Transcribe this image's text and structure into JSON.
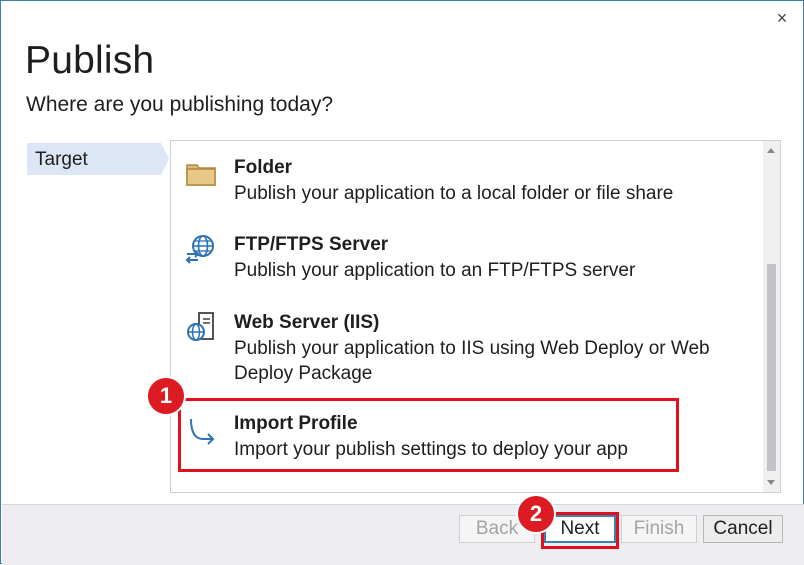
{
  "window": {
    "close_glyph": "×",
    "title": "Publish",
    "subtitle": "Where are you publishing today?"
  },
  "nav": {
    "items": [
      {
        "label": "Target",
        "selected": true
      }
    ]
  },
  "targets": [
    {
      "title": "Folder",
      "description": "Publish your application to a local folder or file share",
      "icon": "folder-icon"
    },
    {
      "title": "FTP/FTPS Server",
      "description": "Publish your application to an FTP/FTPS server",
      "icon": "ftp-globe-icon"
    },
    {
      "title": "Web Server (IIS)",
      "description": "Publish your application to IIS using Web Deploy or Web Deploy Package",
      "icon": "web-server-icon"
    },
    {
      "title": "Import Profile",
      "description": "Import your publish settings to deploy your app",
      "icon": "import-arrow-icon"
    }
  ],
  "annotations": {
    "step1": "1",
    "step2": "2"
  },
  "buttons": {
    "back": "Back",
    "next": "Next",
    "finish": "Finish",
    "cancel": "Cancel"
  },
  "colors": {
    "accent": "#3c7fb1",
    "highlight_red": "#e0101f",
    "nav_selected": "#dde6f5",
    "footer_bg": "#eeeef2"
  }
}
